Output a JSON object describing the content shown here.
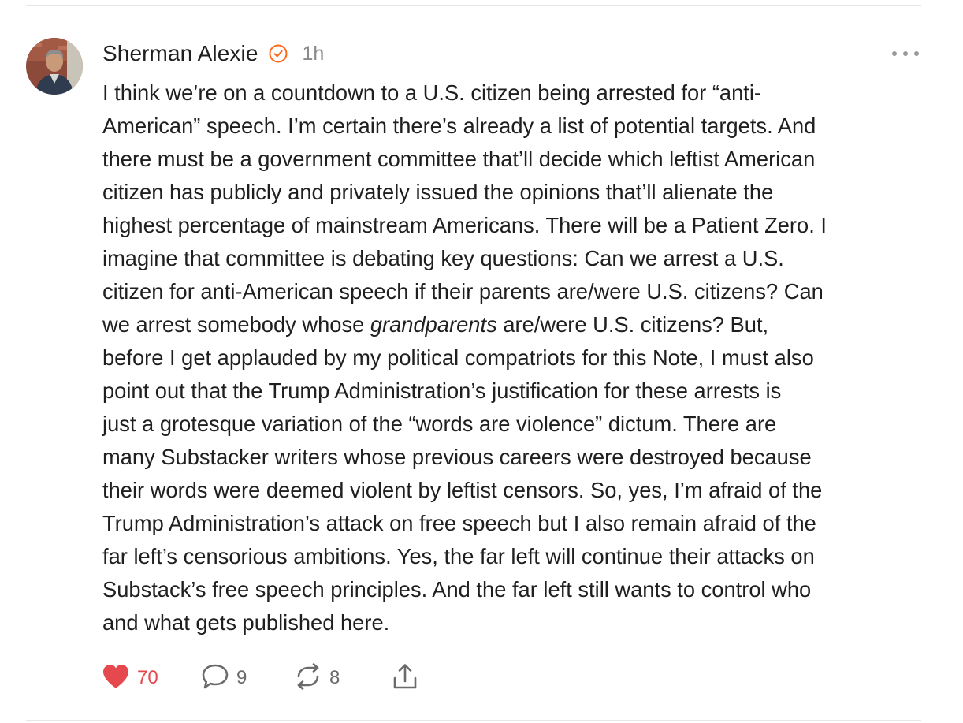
{
  "note": {
    "author": "Sherman Alexie",
    "time": "1h",
    "body_lines": [
      "I think we’re on a countdown to a U.S. citizen being arrested for “anti-",
      "American” speech. I’m certain there’s already a list of potential targets. And",
      "there must be a government committee that’ll decide which leftist American",
      "citizen has publicly and privately issued the opinions that’ll alienate the",
      "highest percentage of mainstream Americans. There will be a Patient Zero. I",
      "imagine that committee is debating key questions: Can we arrest a U.S.",
      "citizen for anti-American speech if their parents are/were U.S. citizens? Can",
      "we arrest somebody whose ",
      "grandparents",
      " are/were U.S. citizens? But,",
      "before I get applauded by my political compatriots for this Note, I must also",
      "point out that the Trump Administration’s justification for these arrests is",
      "just a grotesque variation of the “words are violence” dictum. There are",
      "many Substacker writers whose previous careers were destroyed because",
      "their words were deemed violent by leftist censors. So, yes, I’m afraid of the",
      "Trump Administration’s attack on free speech but I also remain afraid of the",
      "far left’s censorious ambitions. Yes, the far left will continue their attacks on",
      "Substack’s free speech principles. And the far left still wants to control who",
      "and what gets published here."
    ],
    "actions": {
      "likes": "70",
      "comments": "9",
      "restacks": "8"
    },
    "icons": {
      "verified": "verified-badge-icon",
      "more": "more-dots-icon",
      "like": "heart-icon",
      "comment": "comment-bubble-icon",
      "restack": "restack-icon",
      "share": "share-icon"
    },
    "colors": {
      "like": "#e5484d",
      "verified": "#ff6719",
      "muted": "#8a8a8a"
    }
  }
}
